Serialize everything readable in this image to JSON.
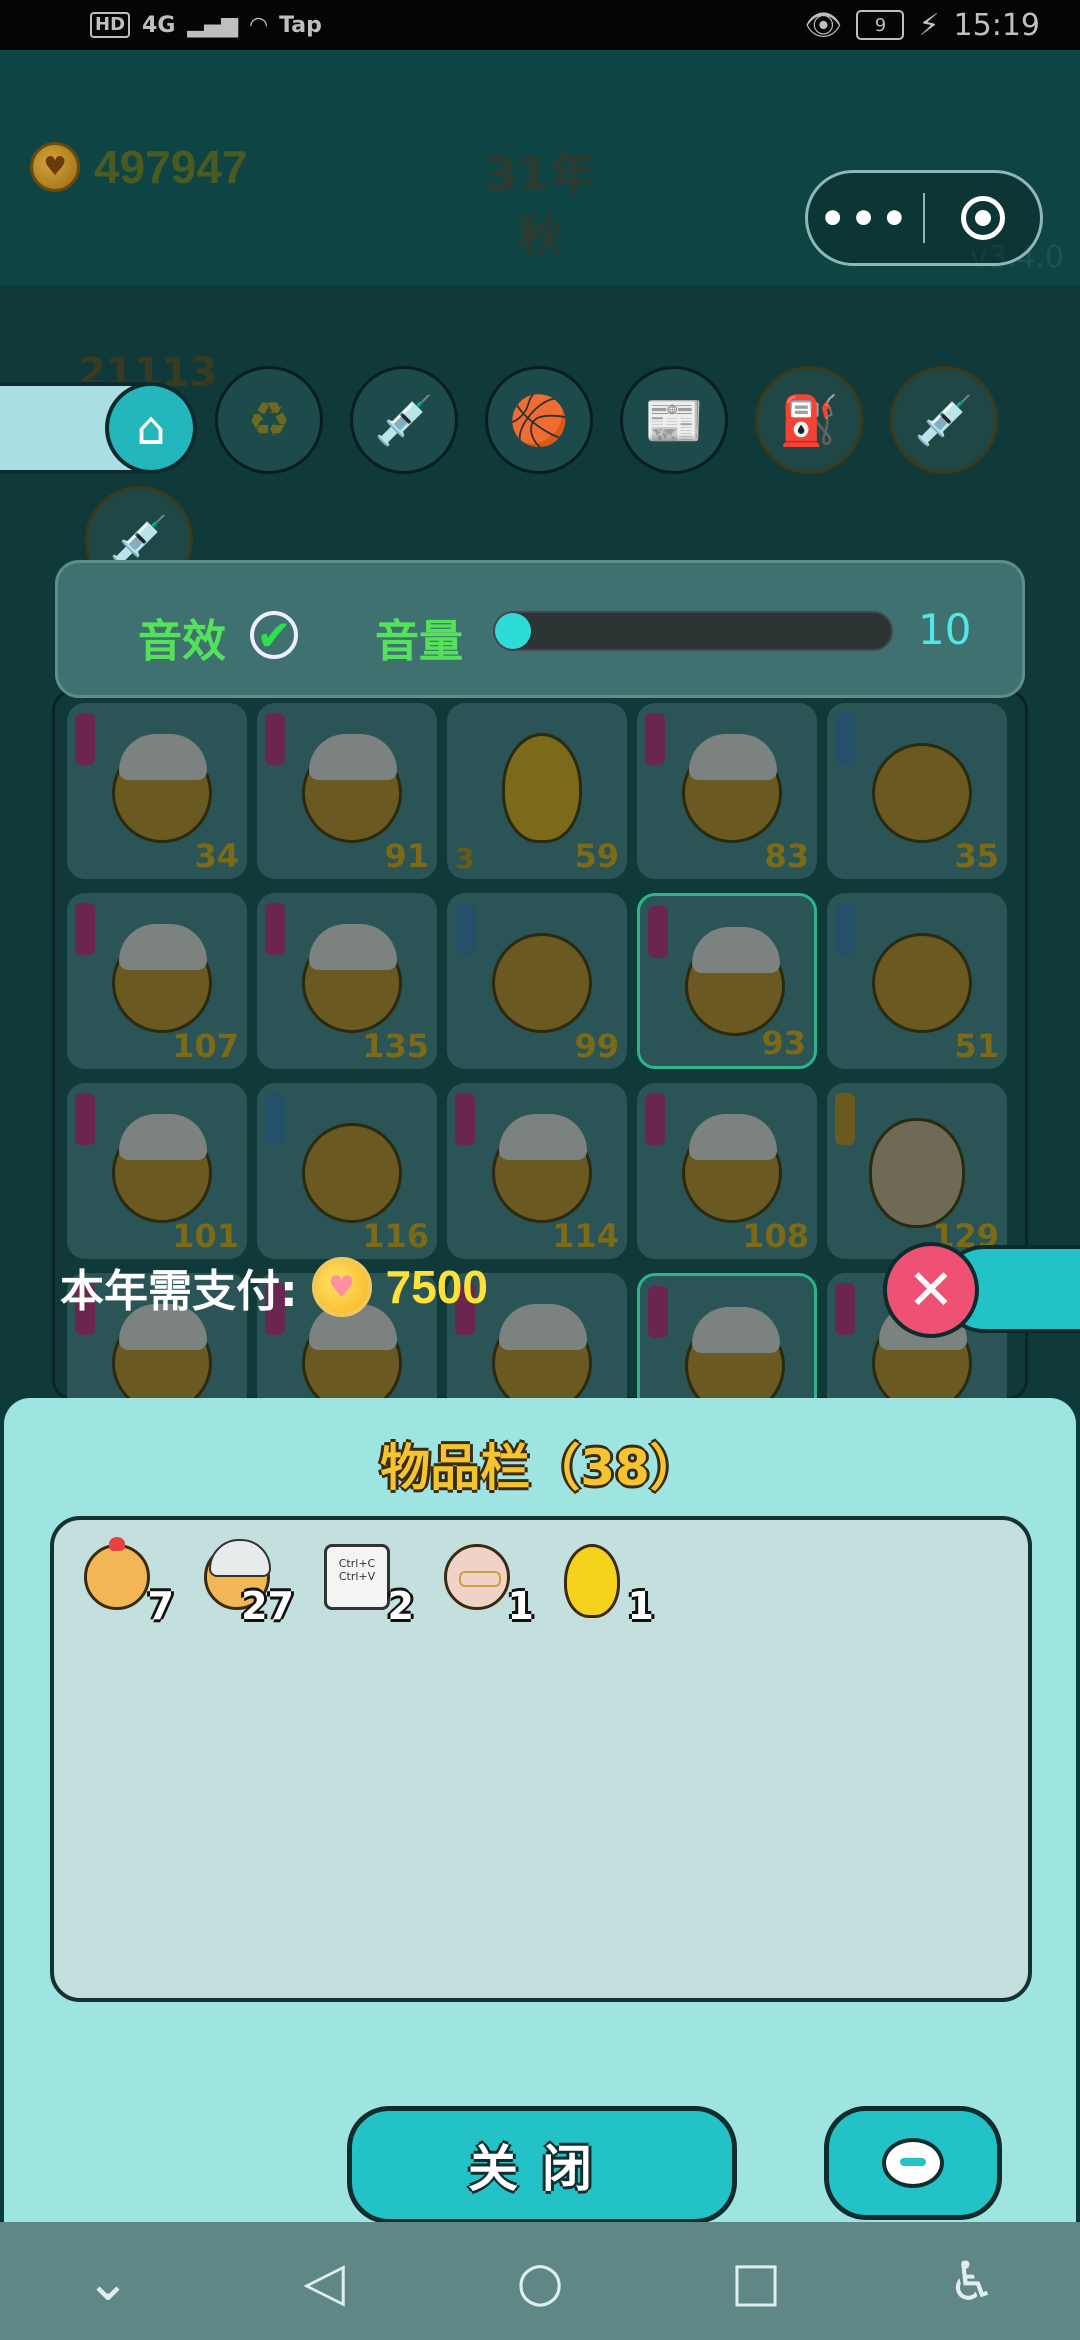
{
  "status_bar": {
    "left_badge": "HD",
    "network": "4G",
    "carrier_tag": "Tap",
    "battery": "9",
    "time": "15:19"
  },
  "header": {
    "gold": "497947",
    "year": "31年",
    "season": "秋",
    "version": "v3.4.0",
    "more_icon": "more-dots-icon",
    "target_icon": "record-target-icon"
  },
  "tools": {
    "count_label": "21113",
    "home_icon": "home-icon",
    "items": [
      "♻",
      "💉",
      "🏀",
      "📰",
      "⛽",
      "💉",
      "💉"
    ]
  },
  "sound_panel": {
    "effects_label": "音效",
    "effects_checked": true,
    "volume_label": "音量",
    "volume_value": "10",
    "volume_fraction": 0.0
  },
  "grid": {
    "cells": [
      {
        "tag": "pink",
        "type": "hair",
        "num": "34"
      },
      {
        "tag": "pink",
        "type": "hair",
        "num": "91"
      },
      {
        "tag": "",
        "type": "egg",
        "num": "59",
        "left_num": "3"
      },
      {
        "tag": "pink",
        "type": "hair",
        "num": "83"
      },
      {
        "tag": "blue",
        "type": "chick",
        "num": "35"
      },
      {
        "tag": "pink",
        "type": "hair",
        "num": "107"
      },
      {
        "tag": "pink",
        "type": "hair",
        "num": "135"
      },
      {
        "tag": "blue",
        "type": "chick",
        "num": "99"
      },
      {
        "tag": "pink",
        "type": "hair",
        "num": "93",
        "selected": true
      },
      {
        "tag": "blue",
        "type": "chick",
        "num": "51"
      },
      {
        "tag": "pink",
        "type": "hair",
        "num": "101"
      },
      {
        "tag": "blue",
        "type": "chick",
        "num": "116"
      },
      {
        "tag": "pink",
        "type": "hair",
        "num": "114"
      },
      {
        "tag": "pink",
        "type": "hair",
        "num": "108"
      },
      {
        "tag": "yellow",
        "type": "face",
        "num": "129"
      },
      {
        "tag": "pink",
        "type": "hair",
        "num": ""
      },
      {
        "tag": "pink",
        "type": "hair",
        "num": ""
      },
      {
        "tag": "pink",
        "type": "hair",
        "num": ""
      },
      {
        "tag": "pink",
        "type": "hair",
        "num": "",
        "selected": true
      },
      {
        "tag": "pink",
        "type": "hair",
        "num": ""
      }
    ]
  },
  "payment": {
    "label": "本年需支付:",
    "amount": "7500",
    "close_icon": "cancel-x-icon"
  },
  "inventory": {
    "title": "物品栏（38）",
    "items": [
      {
        "icon": "chick",
        "count": "7"
      },
      {
        "icon": "nerd-chick",
        "count": "27"
      },
      {
        "icon": "copy-paste-card",
        "count": "2",
        "card_lines": [
          "Ctrl+C",
          "Ctrl+V"
        ]
      },
      {
        "icon": "grandpa-face",
        "count": "1"
      },
      {
        "icon": "golden-egg",
        "count": "1"
      }
    ],
    "close_label": "关闭",
    "chat_icon": "chat-bubble-icon"
  },
  "navbar": {
    "items": [
      "⌄",
      "◁",
      "○",
      "□",
      "♿"
    ]
  }
}
